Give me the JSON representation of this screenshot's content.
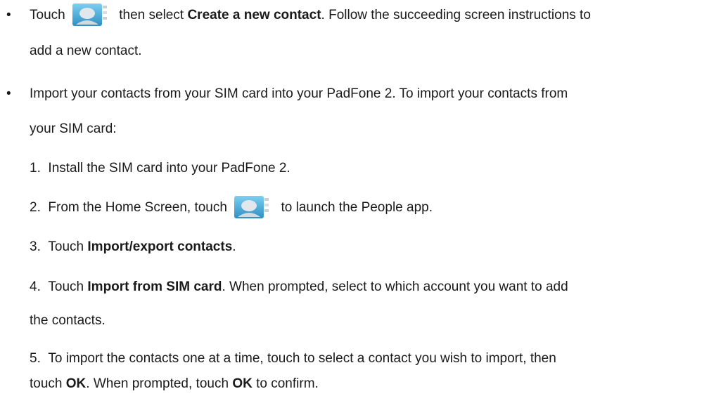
{
  "icons": {
    "people_app": "people-app-icon"
  },
  "colors": {
    "text": "#1a1a1a",
    "icon_frame": "#2f8fc4",
    "icon_frame_light": "#6fc3ea",
    "icon_face": "#d8dfe5",
    "icon_side": "#c9cfd3"
  },
  "bullets": [
    {
      "pre": "Touch",
      "mid": "then select",
      "bold": "Create a new contact",
      "rest_line1": ". Follow the succeeding screen instructions to",
      "line2": "add a new contact."
    },
    {
      "line1": "Import your contacts from your SIM card into your PadFone 2. To import your contacts from",
      "line2": "your SIM card:"
    }
  ],
  "steps": [
    {
      "num": "1.",
      "text": "Install the SIM card into your PadFone 2."
    },
    {
      "num": "2.",
      "pre": "From the Home Screen, touch",
      "post": "to launch the People app."
    },
    {
      "num": "3.",
      "pre": "Touch",
      "bold": "Import/export contacts",
      "post": "."
    },
    {
      "num": "4.",
      "pre": "Touch",
      "bold": "Import from SIM card",
      "post": ". When prompted, select to which account you want to add",
      "line2": "the contacts."
    },
    {
      "num": "5.",
      "line1": "To import the contacts one at a time, touch to select a contact you wish to import, then",
      "line2_pre": "touch",
      "line2_bold1": "OK",
      "line2_mid": ". When prompted, touch",
      "line2_bold2": "OK",
      "line2_post": "to confirm."
    }
  ]
}
